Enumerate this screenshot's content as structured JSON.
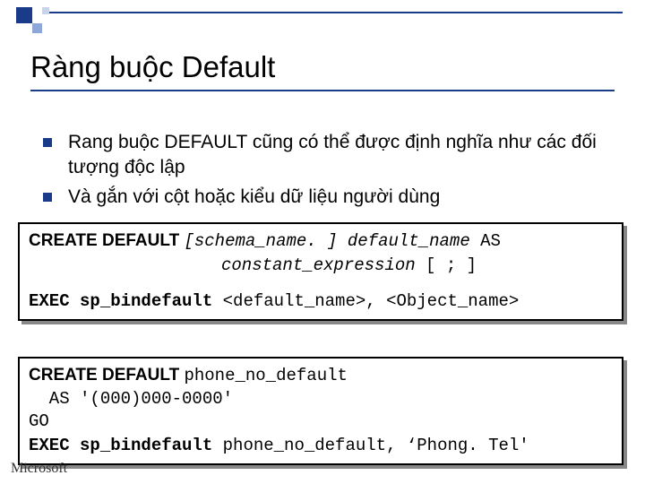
{
  "header": {
    "title": "Ràng buộc Default"
  },
  "bullets": [
    "Rang buộc DEFAULT cũng có thể được định nghĩa như các đối tượng độc lập",
    "Và gắn với cột hoặc kiểu dữ liệu người dùng"
  ],
  "code1": {
    "l1a": "CREATE DEFAULT ",
    "l1b": "[schema_name. ] default_name ",
    "l1c": "AS",
    "l2a": "constant_expression ",
    "l2b": "[ ; ]",
    "l3a": "EXEC sp_bindefault ",
    "l3b": "<default_name>, <Object_name>"
  },
  "code2": {
    "l1a": "CREATE DEFAULT ",
    "l1b": "phone_no_default",
    "l2": "  AS '(000)000-0000'",
    "l3": "GO",
    "l4a": "EXEC sp_bindefault ",
    "l4b": "phone_no_default, ‘Phong. Tel'"
  },
  "footer": {
    "text": "Microsoft"
  }
}
